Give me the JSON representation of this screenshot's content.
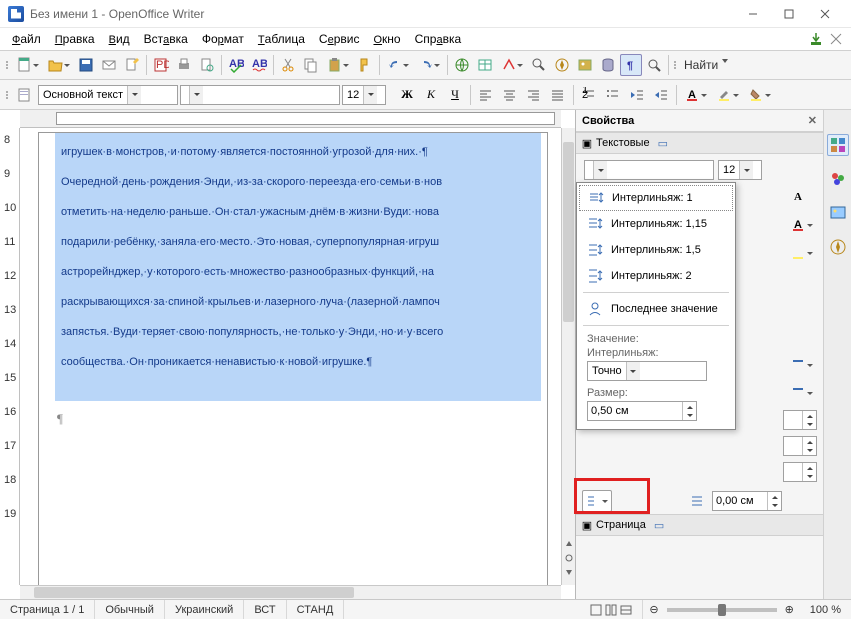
{
  "title": "Без имени 1 - OpenOffice Writer",
  "menus": [
    "Файл",
    "Правка",
    "Вид",
    "Вставка",
    "Формат",
    "Таблица",
    "Сервис",
    "Окно",
    "Справка"
  ],
  "find_label": "Найти",
  "format": {
    "para_style": "Основной текст",
    "font_name": "",
    "font_size": "12"
  },
  "document_text": {
    "l1": "игрушек·в·монстров,·и·потому·является·постоянной·угрозой·для·них.·¶",
    "l2": "Очередной·день·рождения·Энди,·из-за·скорого·переезда·его·семьи·в·нов",
    "l3": "отметить·на·неделю·раньше.·Он·стал·ужасным·днём·в·жизни·Вуди:·нова",
    "l4": "подарили·ребёнку,·заняла·его·место.·Это·новая,·суперпопулярная·игруш",
    "l5": "астрорейнджер,·у·которого·есть·множество·разнообразных·функций,·на",
    "l6": "раскрывающихся·за·спиной·крыльев·и·лазерного·луча·(лазерной·лампоч",
    "l7": "запястья.·Вуди·теряет·свою·популярность,·не·только·у·Энди,·но·и·у·всего",
    "l8": "сообщества.·Он·проникается·ненавистью·к·новой·игрушке.¶"
  },
  "ruler_v": [
    "8",
    "9",
    "10",
    "11",
    "12",
    "13",
    "14",
    "15",
    "16",
    "17",
    "18",
    "19"
  ],
  "sidebar": {
    "title": "Свойства",
    "section_text": "Текстовые",
    "section_page": "Страница",
    "font_size": "12",
    "dropdown": {
      "i1": "Интерлиньяж: 1",
      "i2": "Интерлиньяж: 1,15",
      "i3": "Интерлиньяж: 1,5",
      "i4": "Интерлиньяж: 2",
      "i5": "Последнее значение",
      "lbl_value": "Значение:",
      "lbl_spacing": "Интерлиньяж:",
      "spacing_sel": "Точно",
      "lbl_size": "Размер:",
      "size_val": "0,50 см"
    },
    "indent_val": "0,00 см"
  },
  "status": {
    "page": "Страница  1 / 1",
    "style": "Обычный",
    "lang": "Украинский",
    "ins": "ВСТ",
    "std": "СТАНД",
    "zoom": "100 %"
  }
}
